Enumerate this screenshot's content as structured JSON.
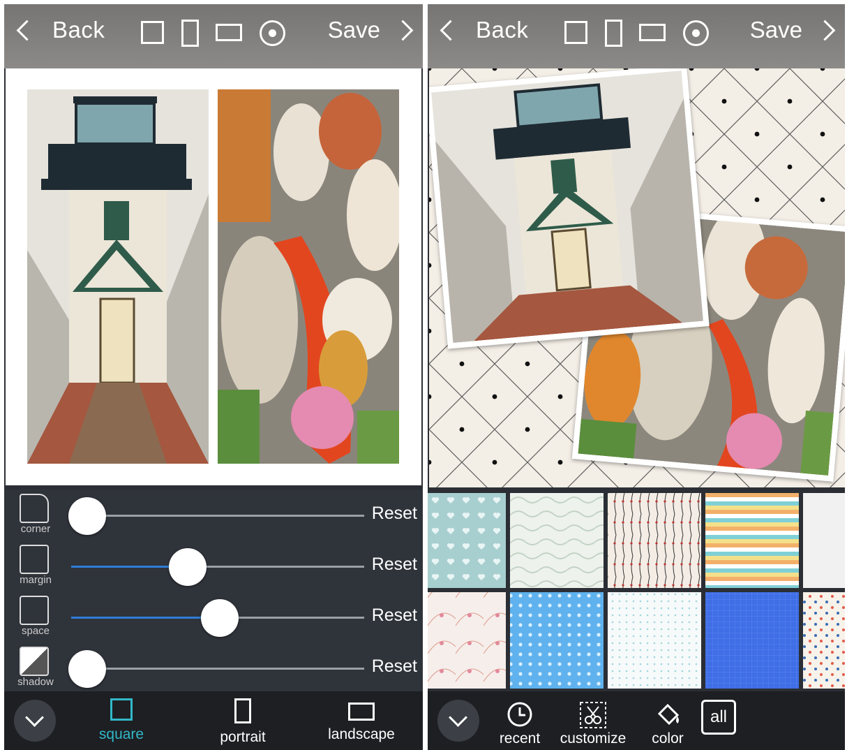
{
  "left": {
    "topbar": {
      "back_label": "Back",
      "save_label": "Save"
    },
    "controls": [
      {
        "id": "corner",
        "label": "corner",
        "value": 0.0,
        "reset_label": "Reset"
      },
      {
        "id": "margin",
        "label": "margin",
        "value": 0.38,
        "reset_label": "Reset"
      },
      {
        "id": "space",
        "label": "space",
        "value": 0.5,
        "reset_label": "Reset"
      },
      {
        "id": "shadow",
        "label": "shadow",
        "value": 0.0,
        "reset_label": "Reset"
      }
    ],
    "nav": {
      "square_label": "square",
      "portrait_label": "portrait",
      "landscape_label": "landscape",
      "active": "square"
    }
  },
  "right": {
    "topbar": {
      "back_label": "Back",
      "save_label": "Save"
    },
    "nav": {
      "recent_label": "recent",
      "customize_label": "customize",
      "color_label": "color",
      "all_label": "all"
    }
  },
  "colors": {
    "accent": "#2e7dd7",
    "active_tab": "#32b8c8"
  }
}
